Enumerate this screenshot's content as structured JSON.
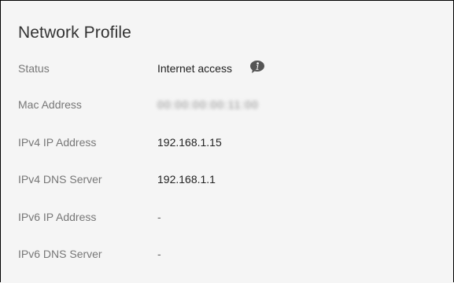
{
  "panel": {
    "title": "Network Profile"
  },
  "fields": {
    "status": {
      "label": "Status",
      "value": "Internet access",
      "info_icon": "info-icon"
    },
    "mac": {
      "label": "Mac Address",
      "value": "00:00:00:00:11:00"
    },
    "ipv4_ip": {
      "label": "IPv4 IP Address",
      "value": "192.168.1.15"
    },
    "ipv4_dns": {
      "label": "IPv4 DNS Server",
      "value": "192.168.1.1"
    },
    "ipv6_ip": {
      "label": "IPv6 IP Address",
      "value": "-"
    },
    "ipv6_dns": {
      "label": "IPv6 DNS Server",
      "value": "-"
    }
  },
  "colors": {
    "background": "#f5f5f5",
    "label": "#777777",
    "value": "#222222",
    "icon": "#555555"
  }
}
